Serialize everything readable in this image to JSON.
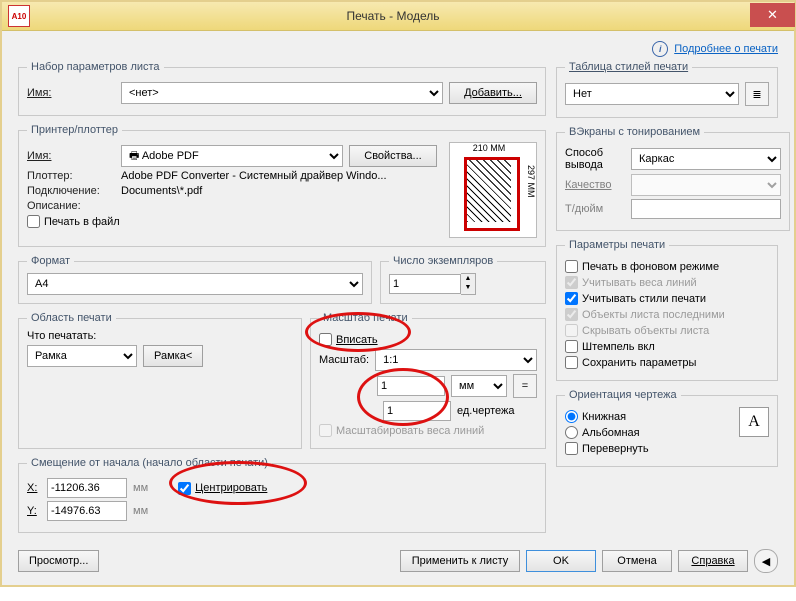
{
  "window": {
    "app_icon": "A10",
    "title": "Печать - Модель",
    "close": "✕"
  },
  "help_link": "Подробнее о печати",
  "pageset": {
    "legend": "Набор параметров листа",
    "name_label": "Имя:",
    "name_value": "<нет>",
    "add_btn": "Добавить..."
  },
  "printer": {
    "legend": "Принтер/плоттер",
    "name_label": "Имя:",
    "name_value": "Adobe PDF",
    "props_btn": "Свойства...",
    "plotter_label": "Плоттер:",
    "plotter_value": "Adobe PDF Converter - Системный драйвер Windo...",
    "conn_label": "Подключение:",
    "conn_value": "Documents\\*.pdf",
    "desc_label": "Описание:",
    "to_file": "Печать в файл",
    "dim_w": "210 MM",
    "dim_h": "297 MM"
  },
  "format": {
    "legend": "Формат",
    "value": "A4"
  },
  "copies": {
    "legend": "Число экземпляров",
    "value": "1"
  },
  "area": {
    "legend": "Область печати",
    "what_label": "Что печатать:",
    "value": "Рамка",
    "window_btn": "Рамка<"
  },
  "scale": {
    "legend": "Масштаб печати",
    "fit": "Вписать",
    "scale_label": "Масштаб:",
    "scale_value": "1:1",
    "paper": "1",
    "units": "мм",
    "drawing": "1",
    "units_dwg": "ед.чертежа",
    "scale_lw": "Масштабировать веса линий",
    "eq": "="
  },
  "offset": {
    "legend": "Смещение от начала (начало области печати)",
    "x_label": "X:",
    "x_value": "-11206.36",
    "y_label": "Y:",
    "y_value": "-14976.63",
    "mm": "мм",
    "center": "Центрировать"
  },
  "styles": {
    "legend": "Таблица стилей печати",
    "value": "Нет"
  },
  "viewports": {
    "legend": "ВЭкраны с тонированием",
    "mode_label": "Способ вывода",
    "mode_value": "Каркас",
    "quality": "Качество",
    "dpi": "Т/дюйм"
  },
  "options": {
    "legend": "Параметры печати",
    "bg": "Печать в фоновом режиме",
    "lw": "Учитывать веса линий",
    "styles": "Учитывать стили печати",
    "last": "Объекты листа последними",
    "hide": "Скрывать объекты листа",
    "stamp": "Штемпель вкл",
    "save": "Сохранить параметры"
  },
  "orient": {
    "legend": "Ориентация чертежа",
    "portrait": "Книжная",
    "landscape": "Альбомная",
    "reverse": "Перевернуть",
    "icon": "A"
  },
  "footer": {
    "preview": "Просмотр...",
    "apply": "Применить к листу",
    "ok": "OK",
    "cancel": "Отмена",
    "help": "Справка"
  }
}
